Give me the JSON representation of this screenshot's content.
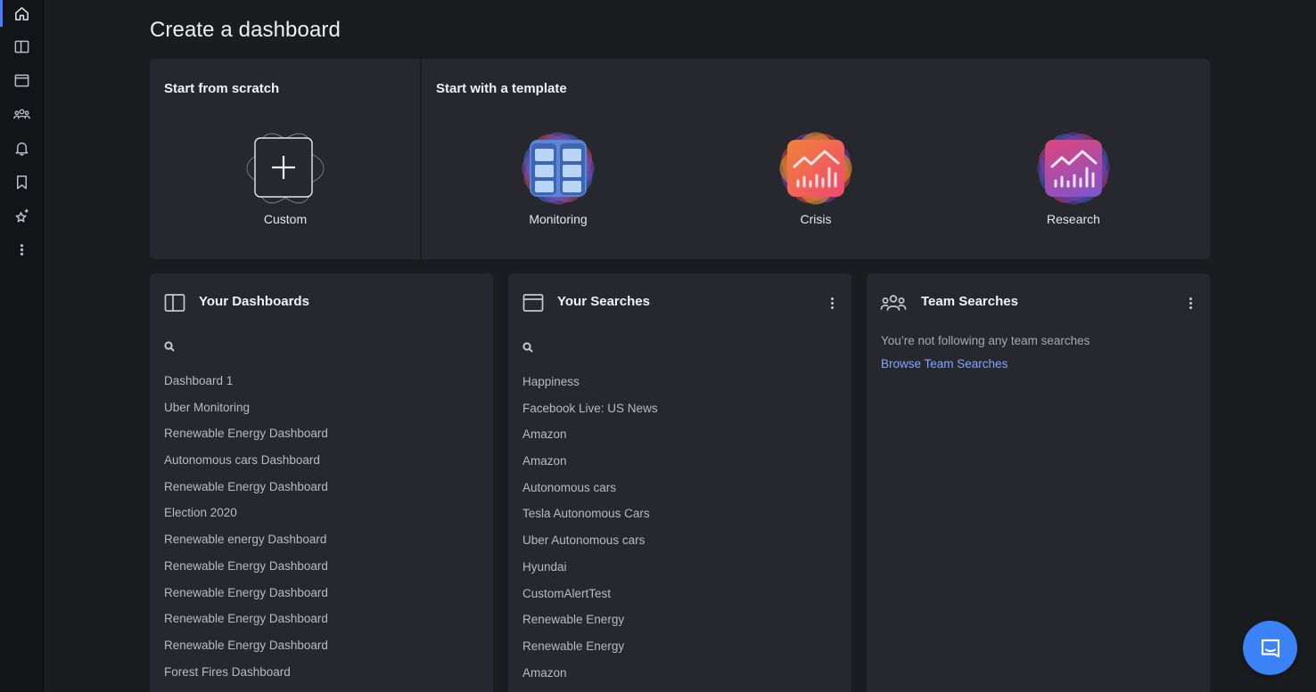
{
  "sidebar": {
    "items": [
      {
        "icon": "home-icon",
        "active": true
      },
      {
        "icon": "dashboards-icon"
      },
      {
        "icon": "searches-icon"
      },
      {
        "icon": "team-icon"
      },
      {
        "icon": "bell-icon"
      },
      {
        "icon": "bookmark-icon"
      },
      {
        "icon": "sparkle-star-icon"
      },
      {
        "icon": "more-vertical-icon"
      }
    ]
  },
  "page": {
    "title": "Create a dashboard"
  },
  "start": {
    "scratch_heading": "Start from scratch",
    "template_heading": "Start with a template",
    "custom_label": "Custom",
    "templates": [
      {
        "label": "Monitoring",
        "icon": "monitoring-icon",
        "color": "#5b86d6"
      },
      {
        "label": "Crisis",
        "icon": "crisis-chart-icon",
        "color": "#f0486f"
      },
      {
        "label": "Research",
        "icon": "research-chart-icon",
        "color": "#a64fc7"
      }
    ]
  },
  "dashboards": {
    "title": "Your Dashboards",
    "items": [
      "Dashboard 1",
      "Uber Monitoring",
      "Renewable Energy Dashboard",
      "Autonomous cars Dashboard",
      "Renewable Energy Dashboard",
      "Election 2020",
      "Renewable energy Dashboard",
      "Renewable Energy Dashboard",
      "Renewable Energy Dashboard",
      "Renewable Energy Dashboard",
      "Renewable Energy Dashboard",
      "Forest Fires Dashboard"
    ]
  },
  "searches": {
    "title": "Your Searches",
    "items": [
      "Happiness",
      "Facebook Live: US News",
      "Amazon",
      "Amazon",
      "Autonomous cars",
      "Tesla Autonomous Cars",
      "Uber Autonomous cars",
      "Hyundai",
      "CustomAlertTest",
      "Renewable Energy",
      "Renewable Energy",
      "Amazon"
    ]
  },
  "team": {
    "title": "Team Searches",
    "empty_message": "You’re not following any team searches",
    "browse_link": "Browse Team Searches"
  },
  "chat": {
    "icon": "chat-bubble-icon",
    "color": "#3b82f6"
  }
}
